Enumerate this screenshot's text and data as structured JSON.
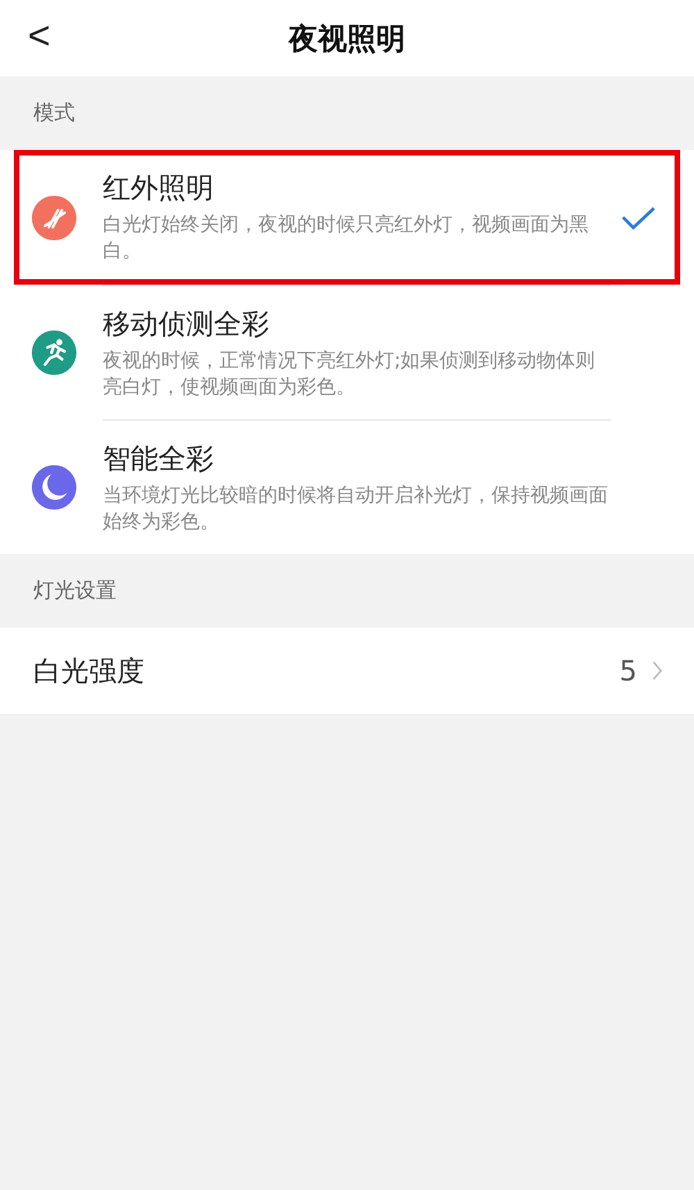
{
  "header": {
    "back": "<",
    "title": "夜视照明"
  },
  "mode_section": {
    "label": "模式",
    "items": [
      {
        "kind": "infrared",
        "title": "红外照明",
        "description": "白光灯始终关闭，夜视的时候只亮红外灯，视频画面为黑白。",
        "selected": true,
        "color": "#f2705e",
        "outlined": true
      },
      {
        "kind": "motion",
        "title": "移动侦测全彩",
        "description": "夜视的时候，正常情况下亮红外灯;如果侦测到移动物体则亮白灯，使视频画面为彩色。",
        "selected": false,
        "color": "#1f9b86",
        "outlined": false
      },
      {
        "kind": "moon",
        "title": "智能全彩",
        "description": "当环境灯光比较暗的时候将自动开启补光灯，保持视频画面始终为彩色。",
        "selected": false,
        "color": "#6a67e8",
        "outlined": false
      }
    ]
  },
  "light_section": {
    "label": "灯光设置",
    "items": [
      {
        "label": "白光强度",
        "value": "5"
      }
    ]
  }
}
